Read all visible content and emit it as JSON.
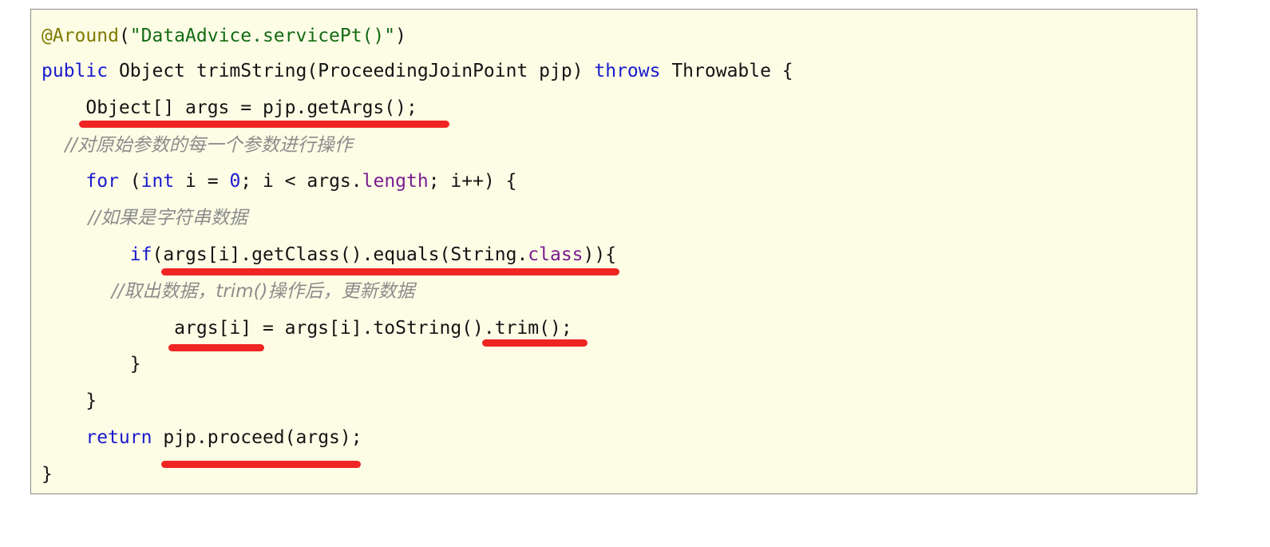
{
  "code": {
    "lines": [
      {
        "tokens": [
          {
            "t": "annot",
            "v": "@Around"
          },
          {
            "t": "plain",
            "v": "("
          },
          {
            "t": "string",
            "v": "\"DataAdvice.servicePt()\""
          },
          {
            "t": "plain",
            "v": ")"
          }
        ]
      },
      {
        "tokens": [
          {
            "t": "kw",
            "v": "public"
          },
          {
            "t": "plain",
            "v": " Object "
          },
          {
            "t": "plain",
            "v": "trimString"
          },
          {
            "t": "plain",
            "v": "(ProceedingJoinPoint pjp) "
          },
          {
            "t": "kw",
            "v": "throws"
          },
          {
            "t": "plain",
            "v": " Throwable {"
          }
        ]
      },
      {
        "tokens": [
          {
            "t": "plain",
            "v": "    Object[] args = pjp.getArgs();"
          }
        ]
      },
      {
        "tokens": [
          {
            "t": "comment",
            "v": "    //对原始参数的每一个参数进行操作"
          }
        ]
      },
      {
        "tokens": [
          {
            "t": "plain",
            "v": "    "
          },
          {
            "t": "kw",
            "v": "for"
          },
          {
            "t": "plain",
            "v": " ("
          },
          {
            "t": "kw",
            "v": "int"
          },
          {
            "t": "plain",
            "v": " i = "
          },
          {
            "t": "num",
            "v": "0"
          },
          {
            "t": "plain",
            "v": "; i < args."
          },
          {
            "t": "field",
            "v": "length"
          },
          {
            "t": "plain",
            "v": "; i++) {"
          }
        ]
      },
      {
        "tokens": [
          {
            "t": "comment",
            "v": "        //如果是字符串数据"
          }
        ]
      },
      {
        "tokens": [
          {
            "t": "plain",
            "v": "        "
          },
          {
            "t": "kw",
            "v": "if"
          },
          {
            "t": "plain",
            "v": "(args[i].getClass().equals(String."
          },
          {
            "t": "field",
            "v": "class"
          },
          {
            "t": "plain",
            "v": ")){"
          }
        ]
      },
      {
        "tokens": [
          {
            "t": "comment",
            "v": "            //取出数据，trim()操作后，更新数据"
          }
        ]
      },
      {
        "tokens": [
          {
            "t": "plain",
            "v": "            args[i] = args[i].toString().trim();"
          }
        ]
      },
      {
        "tokens": [
          {
            "t": "plain",
            "v": "        }"
          }
        ]
      },
      {
        "tokens": [
          {
            "t": "plain",
            "v": "    }"
          }
        ]
      },
      {
        "tokens": [
          {
            "t": "plain",
            "v": "    "
          },
          {
            "t": "kw",
            "v": "return"
          },
          {
            "t": "plain",
            "v": " pjp.proceed(args);"
          }
        ]
      },
      {
        "tokens": [
          {
            "t": "plain",
            "v": "}"
          }
        ]
      }
    ]
  },
  "colors": {
    "background": "#fdfde6",
    "border": "#8a8a8a",
    "highlight_underline": "#ee1212",
    "keyword": "#1a1acc",
    "annotation": "#7f7a00",
    "string": "#136b13",
    "comment": "#8c8c8c",
    "field": "#7a1d8f"
  }
}
